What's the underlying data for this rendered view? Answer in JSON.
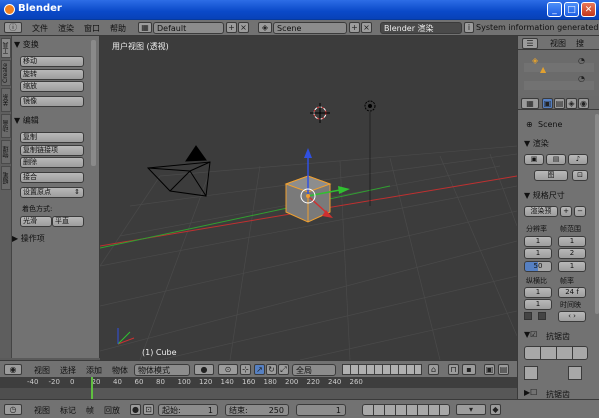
{
  "window": {
    "title": "Blender",
    "min": "_",
    "max": "□",
    "close": "✕"
  },
  "info_header": {
    "menus": [
      "文件",
      "渲染",
      "窗口",
      "帮助"
    ],
    "layout": "Default",
    "scene": "Scene",
    "engine": "Blender 渲染",
    "status": "System information generated in 'system"
  },
  "tool_shelf": {
    "tabs": [
      "工具",
      "Create",
      "关系",
      "动画",
      "物理",
      "蜡笔"
    ],
    "transform": {
      "header": "▼ 变换",
      "buttons": [
        "移动",
        "旋转",
        "缩放",
        "镜像"
      ]
    },
    "edit": {
      "header": "▼ 编辑",
      "buttons": [
        "复制",
        "复制链接项",
        "删除",
        "接合",
        "设置原点"
      ]
    },
    "shading": {
      "label": "着色方式:",
      "smooth": "光滑",
      "flat": "平直"
    },
    "history": "▶ 操作项"
  },
  "viewport": {
    "view_label": "用户视图 (透视)",
    "object_label": "(1) Cube"
  },
  "view_header": {
    "menus": [
      "视图",
      "选择",
      "添加",
      "物体"
    ],
    "mode": "物体模式",
    "pivot": "全局"
  },
  "timeline": {
    "ticks": [
      "-40",
      "-20",
      "0",
      "20",
      "40",
      "60",
      "80",
      "100",
      "120",
      "140",
      "160",
      "180",
      "200",
      "220",
      "240",
      "260"
    ],
    "current_frame_value": 1
  },
  "timeline_header": {
    "menus": [
      "视图",
      "标记",
      "帧",
      "回放"
    ],
    "start_label": "起始:",
    "start_value": "1",
    "end_label": "结束:",
    "end_value": "250",
    "current": "1"
  },
  "outliner": {
    "view": "视图",
    "search": "搜"
  },
  "properties": {
    "scene": "Scene",
    "render_header": "▼ 渲染",
    "render_label": "图",
    "dimensions_header": "▼ 规格尺寸",
    "preset": "渲染预",
    "resolution_label": "分辨率",
    "frame_range_label": "帧范围",
    "res_x": "1",
    "res_y": "1",
    "percent": "50",
    "frame_start": "1",
    "frame_end": "2",
    "frame_step": "1",
    "aspect_label": "纵横比",
    "fps_label": "帧率",
    "aspect_x": "1",
    "aspect_y": "1",
    "fps": "24 f",
    "time_remap_label": "时间映",
    "aa_header": "抗锯齿",
    "motion_blur_header": "抗锯齿"
  }
}
